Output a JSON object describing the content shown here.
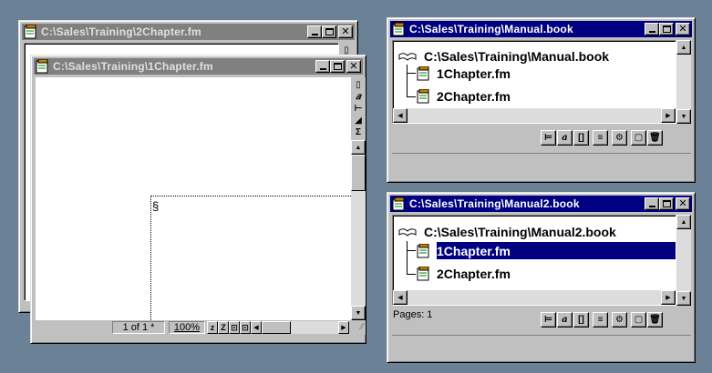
{
  "colors": {
    "desktop": "#6b8296",
    "active_title": "#000080",
    "inactive_title": "#808080",
    "selection": "#000080"
  },
  "win_2chapter": {
    "title": "C:\\Sales\\Training\\2Chapter.fm"
  },
  "win_1chapter": {
    "title": "C:\\Sales\\Training\\1Chapter.fm",
    "section_mark": "§",
    "page_indicator": "1 of 1 *",
    "zoom": "100%",
    "zoom_out": "z",
    "zoom_in": "Z"
  },
  "win_manual": {
    "title": "C:\\Sales\\Training\\Manual.book",
    "root": "C:\\Sales\\Training\\Manual.book",
    "items": [
      "1Chapter.fm",
      "2Chapter.fm"
    ],
    "status": ""
  },
  "win_manual2": {
    "title": "C:\\Sales\\Training\\Manual2.book",
    "root": "C:\\Sales\\Training\\Manual2.book",
    "items": [
      "1Chapter.fm",
      "2Chapter.fm"
    ],
    "selected_item": "1Chapter.fm",
    "status": "Pages: 1"
  },
  "icons": {
    "title_icon": "framemaker-doc-icon",
    "book_icon": "book-icon",
    "file_icon": "fm-file-icon",
    "minimize": "minimize-icon",
    "maximize": "maximize-icon",
    "close": "close-icon"
  }
}
